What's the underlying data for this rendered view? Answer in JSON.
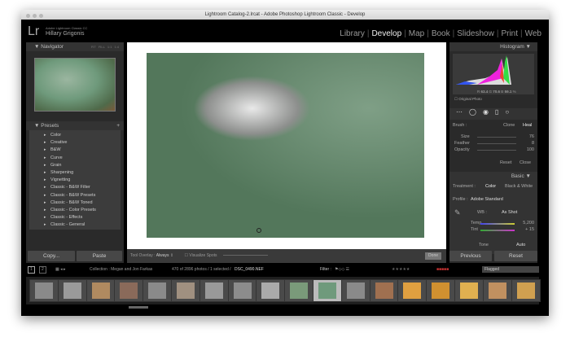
{
  "window": {
    "title": "Lightroom Catalog-2.lrcat - Adobe Photoshop Lightroom Classic - Develop"
  },
  "header": {
    "logo": "Lr",
    "brand": "Adobe Lightroom Classic CC",
    "user": "Hillary Grigonis",
    "modules": [
      "Library",
      "Develop",
      "Map",
      "Book",
      "Slideshow",
      "Print",
      "Web"
    ],
    "active_module": "Develop"
  },
  "navigator": {
    "title": "Navigator",
    "zoom_options": [
      "FIT",
      "FILL",
      "1:1",
      "1:4"
    ]
  },
  "presets": {
    "title": "Presets",
    "add": "+",
    "items": [
      "Color",
      "Creative",
      "B&W",
      "Curve",
      "Grain",
      "Sharpening",
      "Vignetting",
      "Classic - B&W Filter",
      "Classic - B&W Presets",
      "Classic - B&W Toned",
      "Classic - Color Presets",
      "Classic - Effects",
      "Classic - General"
    ]
  },
  "left_buttons": {
    "copy": "Copy...",
    "paste": "Paste"
  },
  "toolbar": {
    "tool_overlay_label": "Tool Overlay :",
    "tool_overlay_value": "Always",
    "visualize_spots": "Visualize Spots",
    "done": "Done"
  },
  "histogram": {
    "title": "Histogram",
    "r": "63.4",
    "g": "70.6",
    "b": "59.1",
    "original_photo": "Original Photo"
  },
  "brush": {
    "label": "Brush :",
    "clone": "Clone",
    "heal": "Heal",
    "size_label": "Size",
    "size": "76",
    "feather_label": "Feather",
    "feather": "8",
    "opacity_label": "Opacity",
    "opacity": "100",
    "reset": "Reset",
    "close": "Close"
  },
  "basic": {
    "title": "Basic",
    "treatment_label": "Treatment :",
    "color": "Color",
    "bw": "Black & White",
    "profile_label": "Profile :",
    "profile": "Adobe Standard",
    "wb_label": "WB :",
    "wb": "As Shot",
    "temp_label": "Temp",
    "temp": "5,200",
    "tint_label": "Tint",
    "tint": "+ 15",
    "tone_label": "Tone",
    "auto": "Auto"
  },
  "right_buttons": {
    "previous": "Previous",
    "reset": "Reset"
  },
  "filmstrip": {
    "pages": [
      "1",
      "2"
    ],
    "collection": "Collection : Megan and Jon Farkas",
    "count": "470 of 2896 photos / 1 selected /",
    "filename": "DSC_0490.NEF",
    "filter_label": "Filter :",
    "stars": "★★★★★",
    "filter_value": "Flagged",
    "thumb_count": 18,
    "selected_index": 10
  }
}
